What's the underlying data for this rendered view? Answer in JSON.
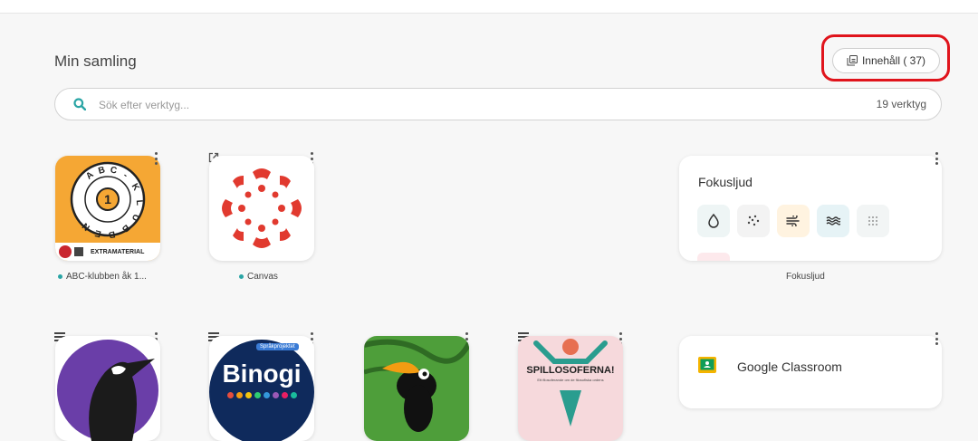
{
  "header": {
    "title": "Min samling",
    "content_button": "Innehåll (  37)"
  },
  "search": {
    "placeholder": "Sök efter verktyg...",
    "count": "19 verktyg"
  },
  "tiles_row1": [
    {
      "label": "ABC-klubben åk 1...",
      "badge": "EXTRAMATERIAL",
      "logo_text": "ABC-KLUBBEN",
      "logo_number": "1"
    },
    {
      "label": "Canvas"
    }
  ],
  "widgets": {
    "fokusljud": {
      "title": "Fokusljud",
      "caption": "Fokusljud",
      "icons": [
        "drop-icon",
        "particles-icon",
        "wind-icon",
        "waves-icon",
        "grid-dots-icon"
      ]
    },
    "google_classroom": {
      "title": "Google Classroom"
    }
  },
  "tiles_row2": [
    {
      "name": "bird-tile"
    },
    {
      "name": "binogi-tile",
      "logo_text": "Binogi",
      "tag": "Språkprojektet"
    },
    {
      "name": "toucan-tile"
    },
    {
      "name": "spillosoferna-tile",
      "logo_text": "SPILLOSOFERNA!",
      "subtext": "Ett filosoferande om de filosofiska ordens"
    }
  ],
  "colors": {
    "accent": "#2aa5a5",
    "annotation": "#e0141c",
    "canvas_red": "#e13a2f",
    "abc_orange": "#f5a734"
  }
}
